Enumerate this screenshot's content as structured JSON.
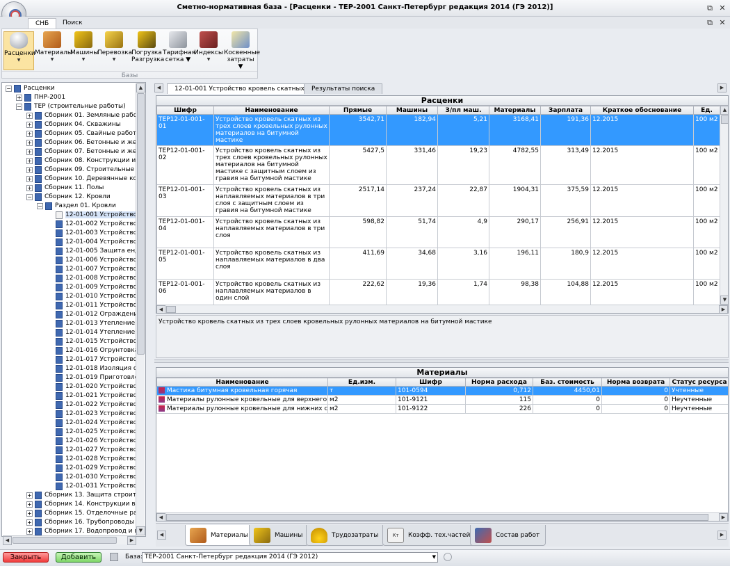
{
  "window": {
    "title": "Сметно-нормативная база - [Расценки - ТЕР-2001 Санкт-Петербург редакция 2014 (ГЭ 2012)]"
  },
  "ribbon": {
    "tabs": [
      "СНБ",
      "Поиск"
    ],
    "group_label": "Базы",
    "buttons": [
      {
        "line1": "Расценки",
        "line2": "▼"
      },
      {
        "line1": "Материалы",
        "line2": "▼"
      },
      {
        "line1": "Машины",
        "line2": "▼"
      },
      {
        "line1": "Перевозка",
        "line2": "▼"
      },
      {
        "line1": "Погрузка",
        "line2": "Разгрузка"
      },
      {
        "line1": "Тарифная",
        "line2": "сетка ▼"
      },
      {
        "line1": "Индексы",
        "line2": "▼"
      },
      {
        "line1": "Косвенные",
        "line2": "затраты ▼"
      }
    ]
  },
  "tree": {
    "items": [
      {
        "label": "Расценки",
        "level": 0,
        "exp": "−",
        "type": "book"
      },
      {
        "label": "ПНР-2001",
        "level": 1,
        "exp": "+",
        "type": "book"
      },
      {
        "label": "ТЕР (строительные работы)",
        "level": 1,
        "exp": "−",
        "type": "book"
      },
      {
        "label": "Сборник 01. Земляные работы",
        "level": 2,
        "exp": "+",
        "type": "book"
      },
      {
        "label": "Сборник 04. Скважины",
        "level": 2,
        "exp": "+",
        "type": "book"
      },
      {
        "label": "Сборник 05. Свайные работы",
        "level": 2,
        "exp": "+",
        "type": "book"
      },
      {
        "label": "Сборник 06. Бетонные и желе",
        "level": 2,
        "exp": "+",
        "type": "book"
      },
      {
        "label": "Сборник 07. Бетонные и желе",
        "level": 2,
        "exp": "+",
        "type": "book"
      },
      {
        "label": "Сборник 08. Конструкции из к",
        "level": 2,
        "exp": "+",
        "type": "book"
      },
      {
        "label": "Сборник 09. Строительные ме",
        "level": 2,
        "exp": "+",
        "type": "book"
      },
      {
        "label": "Сборник 10. Деревянные конс",
        "level": 2,
        "exp": "+",
        "type": "book"
      },
      {
        "label": "Сборник 11. Полы",
        "level": 2,
        "exp": "+",
        "type": "book"
      },
      {
        "label": "Сборник 12. Кровли",
        "level": 2,
        "exp": "−",
        "type": "book"
      },
      {
        "label": "Раздел 01. Кровли",
        "level": 3,
        "exp": "−",
        "type": "book"
      },
      {
        "label": "12-01-001 Устройство",
        "level": 4,
        "exp": "",
        "type": "doc",
        "selected": true
      },
      {
        "label": "12-01-002 Устройство",
        "level": 4,
        "exp": "",
        "type": "book"
      },
      {
        "label": "12-01-003 Устройство",
        "level": 4,
        "exp": "",
        "type": "book"
      },
      {
        "label": "12-01-004 Устройство",
        "level": 4,
        "exp": "",
        "type": "book"
      },
      {
        "label": "12-01-005 Защита енд",
        "level": 4,
        "exp": "",
        "type": "book"
      },
      {
        "label": "12-01-006 Устройство",
        "level": 4,
        "exp": "",
        "type": "book"
      },
      {
        "label": "12-01-007 Устройство",
        "level": 4,
        "exp": "",
        "type": "book"
      },
      {
        "label": "12-01-008 Устройство",
        "level": 4,
        "exp": "",
        "type": "book"
      },
      {
        "label": "12-01-009 Устройство",
        "level": 4,
        "exp": "",
        "type": "book"
      },
      {
        "label": "12-01-010 Устройство",
        "level": 4,
        "exp": "",
        "type": "book"
      },
      {
        "label": "12-01-011 Устройство",
        "level": 4,
        "exp": "",
        "type": "book"
      },
      {
        "label": "12-01-012 Ограждение",
        "level": 4,
        "exp": "",
        "type": "book"
      },
      {
        "label": "12-01-013 Утепление п",
        "level": 4,
        "exp": "",
        "type": "book"
      },
      {
        "label": "12-01-014 Утепление п",
        "level": 4,
        "exp": "",
        "type": "book"
      },
      {
        "label": "12-01-015 Устройство",
        "level": 4,
        "exp": "",
        "type": "book"
      },
      {
        "label": "12-01-016 Огрунтовка",
        "level": 4,
        "exp": "",
        "type": "book"
      },
      {
        "label": "12-01-017 Устройство",
        "level": 4,
        "exp": "",
        "type": "book"
      },
      {
        "label": "12-01-018 Изоляция ст",
        "level": 4,
        "exp": "",
        "type": "book"
      },
      {
        "label": "12-01-019 Приготовлен",
        "level": 4,
        "exp": "",
        "type": "book"
      },
      {
        "label": "12-01-020 Устройство",
        "level": 4,
        "exp": "",
        "type": "book"
      },
      {
        "label": "12-01-021 Устройство",
        "level": 4,
        "exp": "",
        "type": "book"
      },
      {
        "label": "12-01-022 Устройство",
        "level": 4,
        "exp": "",
        "type": "book"
      },
      {
        "label": "12-01-023 Устройство",
        "level": 4,
        "exp": "",
        "type": "book"
      },
      {
        "label": "12-01-024 Устройство",
        "level": 4,
        "exp": "",
        "type": "book"
      },
      {
        "label": "12-01-025 Устройство",
        "level": 4,
        "exp": "",
        "type": "book"
      },
      {
        "label": "12-01-026 Устройство",
        "level": 4,
        "exp": "",
        "type": "book"
      },
      {
        "label": "12-01-027 Устройство",
        "level": 4,
        "exp": "",
        "type": "book"
      },
      {
        "label": "12-01-028 Устройство",
        "level": 4,
        "exp": "",
        "type": "book"
      },
      {
        "label": "12-01-029 Устройство",
        "level": 4,
        "exp": "",
        "type": "book"
      },
      {
        "label": "12-01-030 Устройство",
        "level": 4,
        "exp": "",
        "type": "book"
      },
      {
        "label": "12-01-031 Устройство",
        "level": 4,
        "exp": "",
        "type": "book"
      },
      {
        "label": "Сборник 13. Защита строител",
        "level": 2,
        "exp": "+",
        "type": "book"
      },
      {
        "label": "Сборник 14. Конструкции в се",
        "level": 2,
        "exp": "+",
        "type": "book"
      },
      {
        "label": "Сборник 15. Отделочные рабо",
        "level": 2,
        "exp": "+",
        "type": "book"
      },
      {
        "label": "Сборник 16. Трубопроводы вн",
        "level": 2,
        "exp": "+",
        "type": "book"
      },
      {
        "label": "Сборник 17. Водопровод и ка",
        "level": 2,
        "exp": "+",
        "type": "book"
      }
    ]
  },
  "doc_tabs": [
    "12-01-001 Устройство кровель скатных",
    "Результаты поиска"
  ],
  "rates": {
    "title": "Расценки",
    "columns": [
      "Шифр",
      "Наименование",
      "Прямые",
      "Машины",
      "З/пл маш.",
      "Материалы",
      "Зарплата",
      "Краткое обоснование",
      "Ед."
    ],
    "rows": [
      {
        "code": "ТЕР12-01-001-01",
        "name": "Устройство кровель скатных из трех слоев кровельных рулонных материалов на битумной мастике",
        "direct": "3542,71",
        "machines": "182,94",
        "mach_wage": "5,21",
        "materials": "3168,41",
        "wage": "191,36",
        "basis": "12.2015",
        "unit": "100 м2 к"
      },
      {
        "code": "ТЕР12-01-001-02",
        "name": "Устройство кровель скатных из трех слоев кровельных рулонных материалов на битумной мастике с защитным слоем из гравия на битумной мастике",
        "direct": "5427,5",
        "machines": "331,46",
        "mach_wage": "19,23",
        "materials": "4782,55",
        "wage": "313,49",
        "basis": "12.2015",
        "unit": "100 м2 к"
      },
      {
        "code": "ТЕР12-01-001-03",
        "name": "Устройство кровель скатных из наплавляемых материалов в три слоя с защитным слоем из гравия на битумной мастике",
        "direct": "2517,14",
        "machines": "237,24",
        "mach_wage": "22,87",
        "materials": "1904,31",
        "wage": "375,59",
        "basis": "12.2015",
        "unit": "100 м2 к"
      },
      {
        "code": "ТЕР12-01-001-04",
        "name": "Устройство кровель скатных из наплавляемых материалов в три слоя",
        "direct": "598,82",
        "machines": "51,74",
        "mach_wage": "4,9",
        "materials": "290,17",
        "wage": "256,91",
        "basis": "12.2015",
        "unit": "100 м2 к"
      },
      {
        "code": "ТЕР12-01-001-05",
        "name": "Устройство кровель скатных из наплавляемых материалов в два слоя",
        "direct": "411,69",
        "machines": "34,68",
        "mach_wage": "3,16",
        "materials": "196,11",
        "wage": "180,9",
        "basis": "12.2015",
        "unit": "100 м2 к"
      },
      {
        "code": "ТЕР12-01-001-06",
        "name": "Устройство кровель скатных из наплавляемых материалов в один слой",
        "direct": "222,62",
        "machines": "19,36",
        "mach_wage": "1,74",
        "materials": "98,38",
        "wage": "104,88",
        "basis": "12.2015",
        "unit": "100 м2 к"
      }
    ]
  },
  "description": "Устройство кровель скатных из трех слоев кровельных рулонных материалов на битумной мастике",
  "materials": {
    "title": "Материалы",
    "columns": [
      "Наименование",
      "Ед.изм.",
      "Шифр",
      "Норма расхода",
      "Баз. стоимость",
      "Норма возврата",
      "Статус ресурса"
    ],
    "rows": [
      {
        "name": "Мастика битумная кровельная горячая",
        "unit": "т",
        "code": "101-0594",
        "norm": "0,712",
        "cost": "4450,01",
        "ret": "0",
        "status": "Учтенные"
      },
      {
        "name": "Материалы рулонные кровельные для верхнего слоя",
        "unit": "м2",
        "code": "101-9121",
        "norm": "115",
        "cost": "0",
        "ret": "0",
        "status": "Неучтенные"
      },
      {
        "name": "Материалы рулонные кровельные для нижних слоев",
        "unit": "м2",
        "code": "101-9122",
        "norm": "226",
        "cost": "0",
        "ret": "0",
        "status": "Неучтенные"
      }
    ]
  },
  "bottom_tabs": [
    "Материалы",
    "Машины",
    "Трудозатраты",
    "Коэфф. тех.частей",
    "Состав работ"
  ],
  "bottom_tab_icon_text": "Кт",
  "status": {
    "close_label": "Закрыть",
    "add_label": "Добавить",
    "base_label": "База:",
    "base_value": "ТЕР-2001 Санкт-Петербург редакция 2014 (ГЭ 2012)"
  }
}
